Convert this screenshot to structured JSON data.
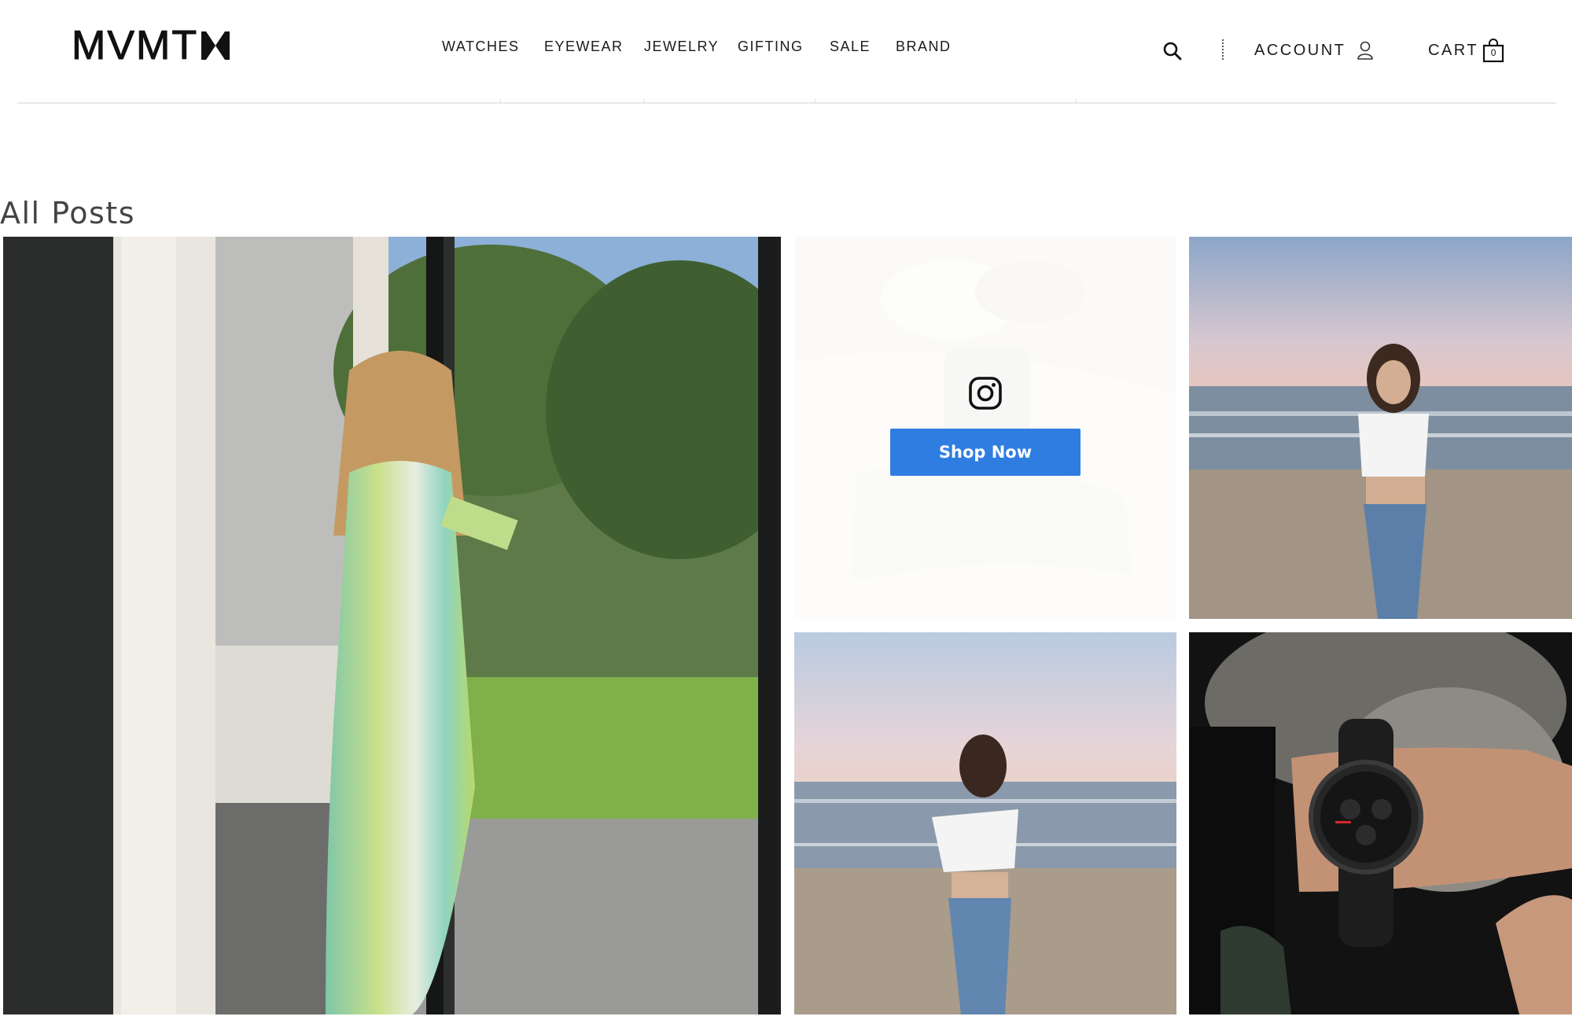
{
  "brand": {
    "name": "MVMT"
  },
  "nav": {
    "items": [
      {
        "label": "WATCHES"
      },
      {
        "label": "EYEWEAR"
      },
      {
        "label": "JEWELRY"
      },
      {
        "label": "GIFTING"
      },
      {
        "label": "SALE"
      },
      {
        "label": "BRAND"
      }
    ]
  },
  "utility": {
    "account_label": "ACCOUNT",
    "cart_label": "CART",
    "cart_count": "0"
  },
  "page": {
    "title": "All Posts"
  },
  "feed": {
    "posts": [
      {
        "alt": "Woman in green striped dress holding wine glass by glass door",
        "icon": "none"
      },
      {
        "alt": "Wrist with white watch",
        "icon": "instagram-icon",
        "cta_label": "Shop Now"
      },
      {
        "alt": "Woman on beach at sunset",
        "icon": "none"
      },
      {
        "alt": "Woman on beach holding hair",
        "icon": "none"
      },
      {
        "alt": "Black chronograph watch on wrist",
        "icon": "none"
      }
    ]
  },
  "colors": {
    "cta": "#2f7de1",
    "text": "#1b1b1b",
    "heading": "#444444"
  }
}
